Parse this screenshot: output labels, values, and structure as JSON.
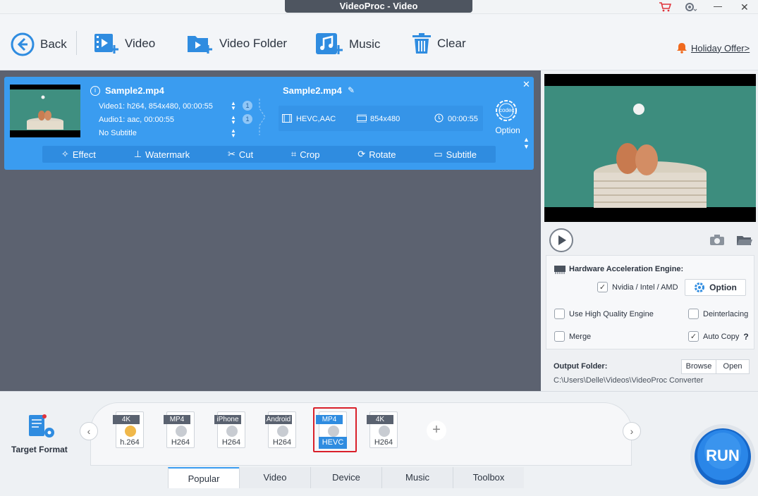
{
  "window": {
    "title": "VideoProc - Video"
  },
  "toolbar": {
    "back": "Back",
    "video": "Video",
    "video_folder": "Video Folder",
    "music": "Music",
    "clear": "Clear",
    "holiday_offer": "Holiday Offer>"
  },
  "item": {
    "input_name": "Sample2.mp4",
    "video_track": "Video1: h264, 854x480, 00:00:55",
    "audio_track": "Audio1: aac, 00:00:55",
    "subtitle": "No Subtitle",
    "video_badge": "1",
    "audio_badge": "1",
    "output_name": "Sample2.mp4",
    "out_codec": "HEVC,AAC",
    "out_res": "854x480",
    "out_dur": "00:00:55",
    "codec_label": "codec",
    "option_label": "Option"
  },
  "edit_tools": [
    "Effect",
    "Watermark",
    "Cut",
    "Crop",
    "Rotate",
    "Subtitle"
  ],
  "settings": {
    "hw_title": "Hardware Acceleration Engine:",
    "nvidia": "Nvidia / Intel / AMD",
    "option": "Option",
    "high_quality": "Use High Quality Engine",
    "deinterlacing": "Deinterlacing",
    "merge": "Merge",
    "auto_copy": "Auto Copy",
    "help": "?",
    "output_folder_label": "Output Folder:",
    "browse": "Browse",
    "open": "Open",
    "output_path": "C:\\Users\\Delle\\Videos\\VideoProc Converter"
  },
  "formats": [
    {
      "top": "4K",
      "bottom": "h.264"
    },
    {
      "top": "MP4",
      "bottom": "H264"
    },
    {
      "top": "iPhone",
      "bottom": "H264"
    },
    {
      "top": "Android",
      "bottom": "H264"
    },
    {
      "top": "MP4",
      "bottom": "HEVC",
      "selected": true
    },
    {
      "top": "4K",
      "bottom": "H264"
    }
  ],
  "target_format": "Target Format",
  "tabs": [
    "Popular",
    "Video",
    "Device",
    "Music",
    "Toolbox"
  ],
  "run": "RUN",
  "colors": {
    "accent": "#3a9cf0",
    "selected": "#d9202a",
    "offer": "#f06a1e"
  }
}
